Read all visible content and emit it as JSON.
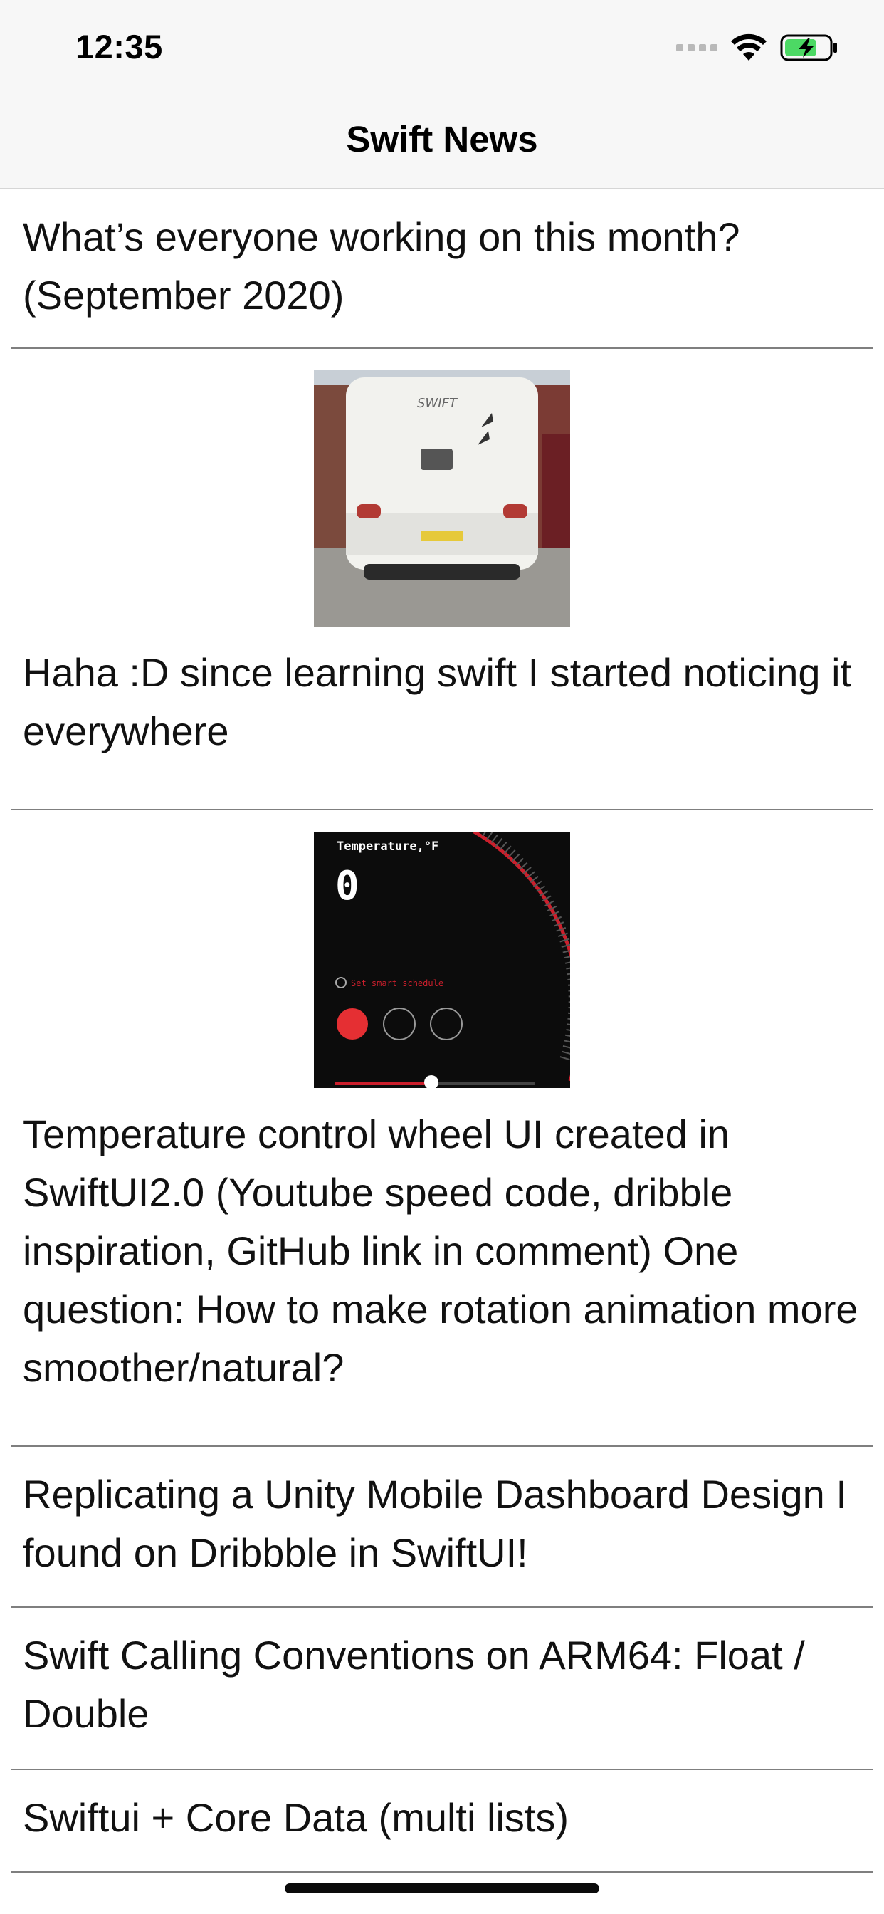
{
  "status_bar": {
    "time": "12:35",
    "icons": [
      "cellular-signal-icon",
      "wifi-icon",
      "battery-charging-icon"
    ],
    "battery_color": "#4cd964"
  },
  "nav": {
    "title": "Swift News"
  },
  "posts": [
    {
      "title": "What’s everyone working on this month? (September 2020)"
    },
    {
      "title": "Haha :D since learning swift I started noticing it everywhere",
      "thumbnail": "caravan-photo"
    },
    {
      "title": "Temperature control wheel UI created in SwiftUI2.0 (Youtube speed code, dribble inspiration, GitHub link in comment) One question: How to make rotation animation more smoother/natural?",
      "thumbnail": "temperature-ui-screenshot",
      "thumbnail_text": {
        "label": "Temperature,°F",
        "value": "0",
        "caption": "Set smart schedule"
      }
    },
    {
      "title": "Replicating a Unity Mobile Dashboard Design I found on Dribbble in SwiftUI!"
    },
    {
      "title": "Swift Calling Conventions on ARM64: Float / Double"
    },
    {
      "title": "Swiftui + Core Data (multi lists)"
    }
  ]
}
